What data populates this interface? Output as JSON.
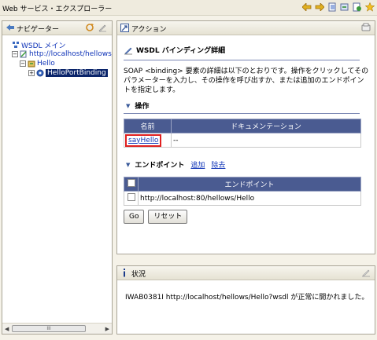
{
  "window": {
    "title": "Web サービス・エクスプローラー"
  },
  "icons": {
    "toolbar": [
      "back-arrow-icon",
      "forward-arrow-icon",
      "page-icon",
      "refresh-icon",
      "wsdl-icon",
      "favorite-star-icon"
    ],
    "accent": "#4a5b91",
    "highlight": "#e02020"
  },
  "navigator": {
    "title": "ナビゲーター",
    "tree": [
      {
        "label": "WSDL メイン",
        "indent": 0
      },
      {
        "label": "http://localhost/hellows/Hello?wsdl",
        "indent": 1
      },
      {
        "label": "Hello",
        "indent": 2
      },
      {
        "label": "HelloPortBinding",
        "indent": 3
      }
    ],
    "scroll_thumb": "III"
  },
  "actions": {
    "title": "アクション",
    "section_title": "WSDL バインディング詳細",
    "description": "SOAP <binding> 要素の詳細は以下のとおりです。操作をクリックしてそのパラメーターを入力し、その操作を呼び出すか、または追加のエンドポイントを指定します。",
    "operations": {
      "heading": "操作",
      "columns": [
        "名前",
        "ドキュメンテーション"
      ],
      "rows": [
        {
          "name": "sayHello",
          "doc": "--"
        }
      ]
    },
    "endpoints": {
      "heading": "エンドポイント",
      "add_link": "追加",
      "remove_link": "除去",
      "column": "エンドポイント",
      "rows": [
        "http://localhost:80/hellows/Hello"
      ]
    },
    "go_label": "Go",
    "reset_label": "リセット"
  },
  "status": {
    "title": "状況",
    "message": "IWAB0381I http://localhost/hellows/Hello?wsdl が正常に開かれました。"
  }
}
